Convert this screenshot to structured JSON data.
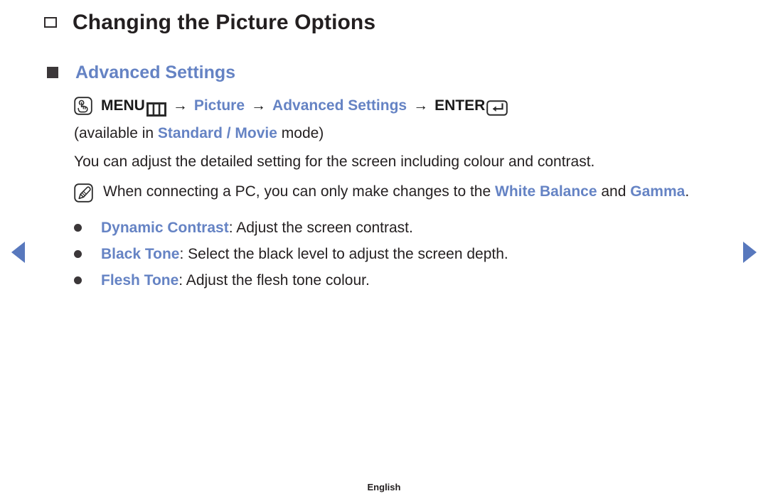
{
  "page": {
    "title": "Changing the Picture Options",
    "section_heading": "Advanced Settings",
    "footer_language": "English",
    "accent_color": "#6583c4",
    "text_color": "#231f20"
  },
  "menu_path": {
    "press_icon": "press-button-icon",
    "menu_label": "MENU",
    "menu_grid_icon": "menu-grid-icon",
    "arrow_1": "→",
    "item_1": "Picture",
    "arrow_2": "→",
    "item_2": "Advanced Settings",
    "arrow_3": "→",
    "enter_label": "ENTER",
    "enter_icon": "enter-return-icon"
  },
  "availability": {
    "prefix": "(available in ",
    "modes": "Standard / Movie",
    "suffix": " mode)"
  },
  "description": "You can adjust the detailed setting for the screen including colour and contrast.",
  "note": {
    "icon": "note-pencil-icon",
    "text_before": "When connecting a PC, you can only make changes to the ",
    "highlight_1": "White Balance",
    "text_middle": " and ",
    "highlight_2": "Gamma",
    "text_after": "."
  },
  "options": [
    {
      "name": "Dynamic Contrast",
      "description": ": Adjust the screen contrast."
    },
    {
      "name": "Black Tone",
      "description": ": Select the black level to adjust the screen depth."
    },
    {
      "name": "Flesh Tone",
      "description": ": Adjust the flesh tone colour."
    }
  ],
  "navigation": {
    "prev_icon": "previous-page-arrow",
    "next_icon": "next-page-arrow"
  }
}
